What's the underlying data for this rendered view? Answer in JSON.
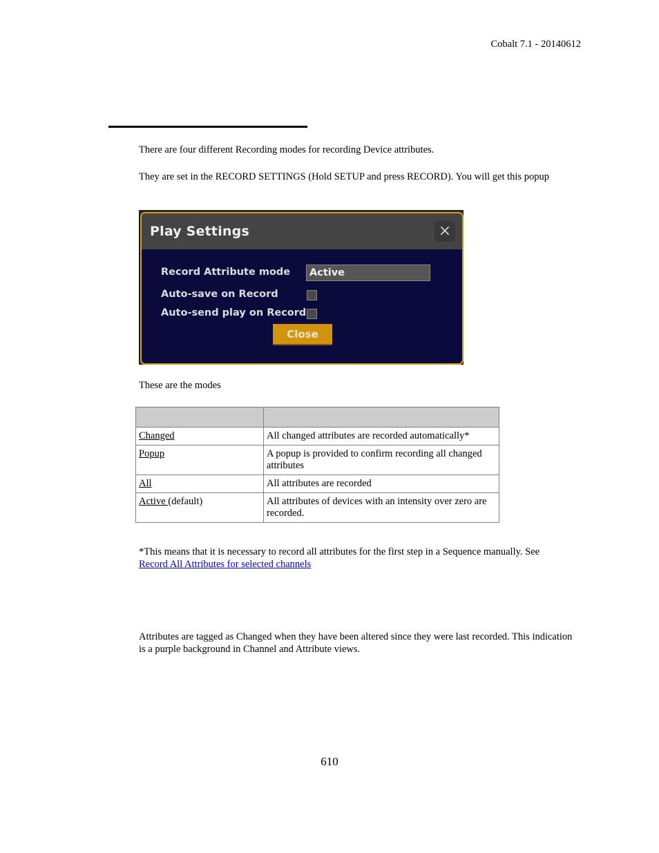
{
  "header": {
    "doc_version": "Cobalt 7.1 - 20140612"
  },
  "intro": {
    "p1": "There are four different Recording modes for recording Device attributes.",
    "p2": "They are set in the RECORD SETTINGS (Hold SETUP and press RECORD). You will get this popup"
  },
  "popup": {
    "title": "Play Settings",
    "close_icon": "×",
    "record_attribute_mode_label": "Record Attribute mode",
    "record_attribute_mode_value": "Active",
    "auto_save_label": "Auto-save on Record",
    "auto_save_checked": false,
    "auto_send_label": "Auto-send play on Record",
    "auto_send_checked": false,
    "close_button": "Close",
    "colors": {
      "border": "#d4a017",
      "body": "#0a0a3c",
      "titlebar": "#444444",
      "button": "#d09410"
    }
  },
  "modes_intro": "These are the modes",
  "modes_table": {
    "headers": [
      "",
      ""
    ],
    "rows": [
      {
        "mode": "Changed",
        "suffix": "",
        "description": "All changed attributes are recorded automatically*"
      },
      {
        "mode": "Popup",
        "suffix": "",
        "description": "A popup is provided to confirm recording all changed attributes"
      },
      {
        "mode": "All",
        "suffix": "",
        "description": "All attributes are recorded"
      },
      {
        "mode": "Active ",
        "suffix": "(default)",
        "description": "All attributes of devices with an intensity over zero are recorded."
      }
    ]
  },
  "footnote": {
    "text": "*This means that it is necessary to record all attributes for the first step in a Sequence manually. See",
    "link": "Record All Attributes for selected channels"
  },
  "changed_section": {
    "text": "Attributes are tagged as Changed when they have been altered since they were last recorded. This indication is a purple background in Channel and Attribute views."
  },
  "footer": {
    "page_number": "610"
  }
}
